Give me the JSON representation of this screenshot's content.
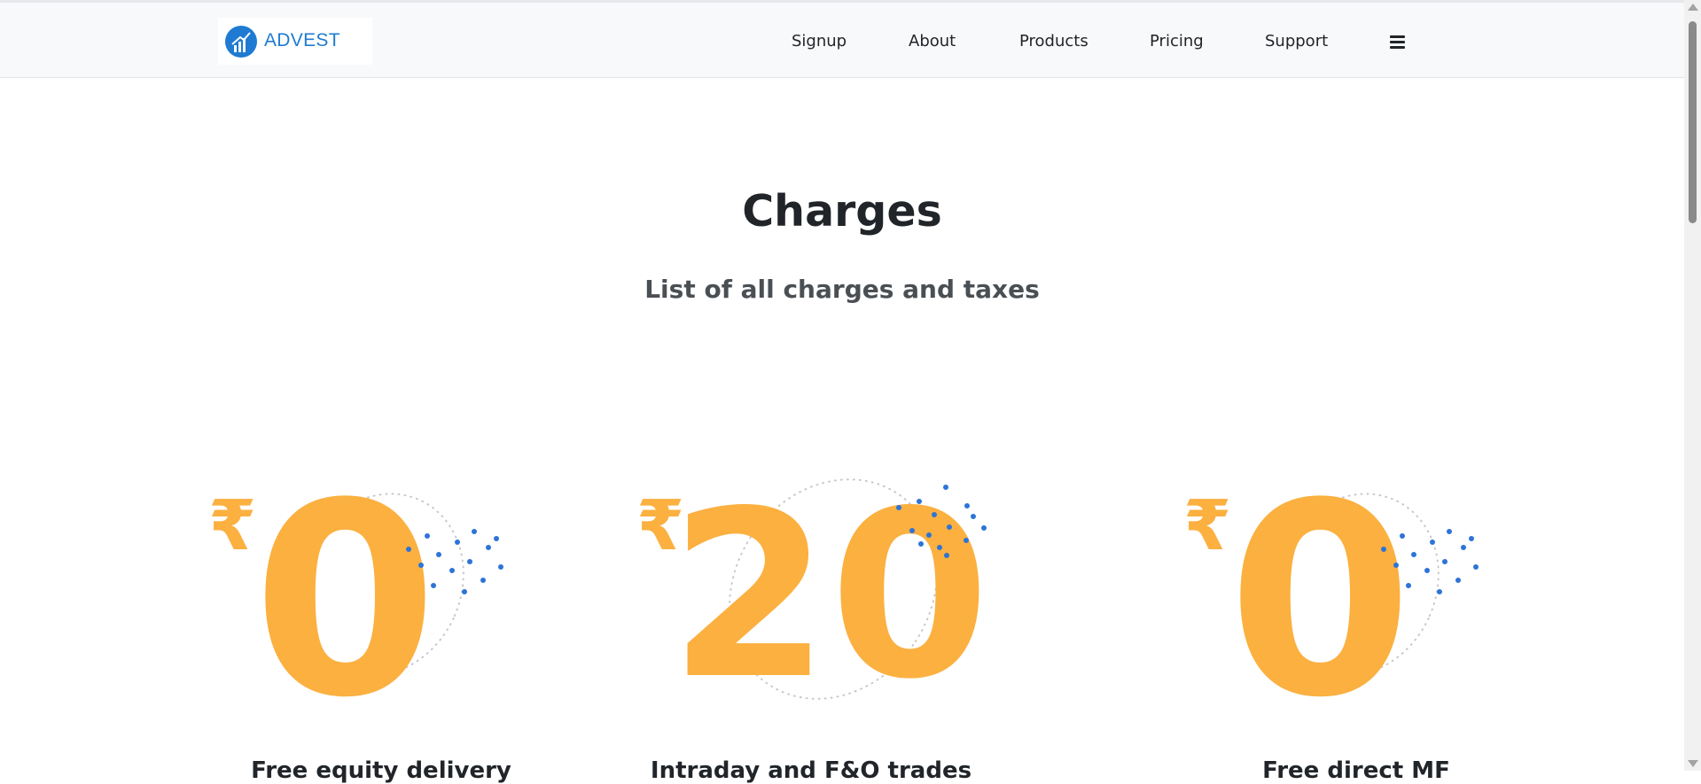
{
  "brand": {
    "name": "ADVEST",
    "logo_icon": "chart-bars-circle-icon"
  },
  "nav": {
    "items": [
      {
        "label": "Signup"
      },
      {
        "label": "About"
      },
      {
        "label": "Products"
      },
      {
        "label": "Pricing"
      },
      {
        "label": "Support"
      }
    ],
    "menu_icon": "hamburger-menu-icon"
  },
  "header": {
    "title": "Charges",
    "subtitle": "List of all charges and taxes"
  },
  "pricing": [
    {
      "currency": "₹",
      "amount": "0",
      "caption": "Free equity delivery"
    },
    {
      "currency": "₹",
      "amount": "20",
      "caption": "Intraday and F&O trades"
    },
    {
      "currency": "₹",
      "amount": "0",
      "caption": "Free direct MF"
    }
  ],
  "colors": {
    "accent": "#fbb040",
    "brand_blue": "#1f7bd1",
    "dot_blue": "#2d74d6"
  }
}
